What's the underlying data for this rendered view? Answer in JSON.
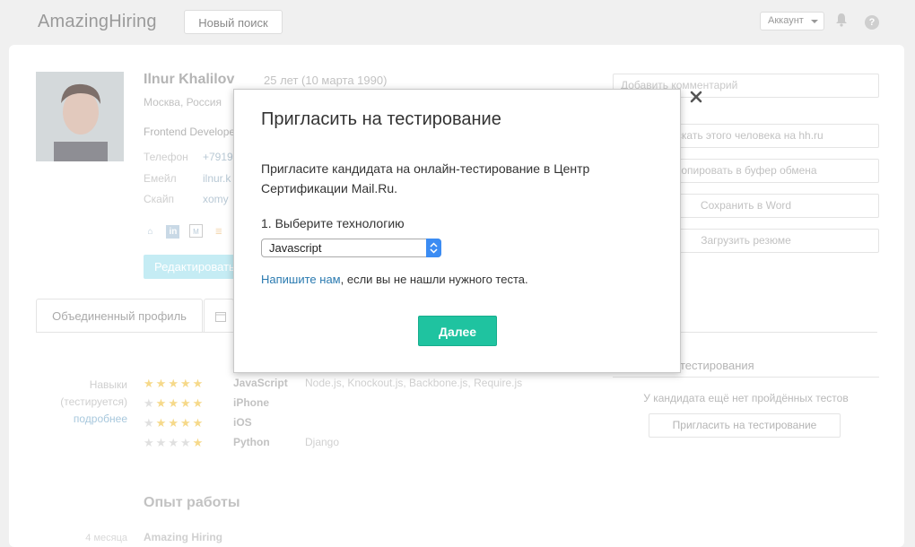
{
  "header": {
    "logo": "AmazingHiring",
    "new_search_label": "Новый поиск",
    "account_label": "Аккаунт",
    "help_label": "?"
  },
  "profile": {
    "name": "Ilnur Khalilov",
    "age": "25 лет (10 марта 1990)",
    "city": "Москва, Россия",
    "position": "Frontend Developer",
    "contacts": [
      {
        "label": "Телефон",
        "value": "+7919"
      },
      {
        "label": "Емейл",
        "value": "ilnur.k"
      },
      {
        "label": "Скайп",
        "value": "xomy"
      }
    ],
    "social_icons": [
      "home-icon",
      "linkedin-icon",
      "moikrug-icon",
      "stackoverflow-icon"
    ],
    "edit_label": "Редактировать"
  },
  "sidebar": {
    "comment_placeholder": "Добавить комментарий",
    "buttons": [
      {
        "label": "Искать этого человека на hh.ru"
      },
      {
        "label": "Копировать в буфер обмена"
      },
      {
        "label": "Сохранить в Word"
      },
      {
        "label": "Загрузить резюме"
      }
    ]
  },
  "tabs": {
    "unified_profile": "Объединенный профиль"
  },
  "skills": {
    "label_line1": "Навыки",
    "label_line2": "(тестируется)",
    "more_link": "подробнее",
    "rows": [
      {
        "stars": 5,
        "name": "JavaScript",
        "tags": "Node.js, Knockout.js, Backbone.js, Require.js"
      },
      {
        "stars": 4,
        "name": "iPhone",
        "tags": ""
      },
      {
        "stars": 4,
        "name": "iOS",
        "tags": ""
      },
      {
        "stars": 1,
        "name": "Python",
        "tags": "Django"
      }
    ]
  },
  "testing": {
    "heading": "тестирования",
    "no_tests": "У кандидата ещё нет пройдённых тестов",
    "invite_label": "Пригласить на тестирование"
  },
  "work": {
    "heading": "Опыт работы",
    "company": "Amazing Hiring",
    "date": "4 месяца"
  },
  "modal": {
    "title": "Пригласить на тестирование",
    "description": "Пригласите кандидата на онлайн-тестирование в Центр Сертификации Mail.Ru.",
    "step_label": "1. Выберите технологию",
    "selected_tech": "Javascript",
    "help_link": "Напишите нам",
    "help_rest": ", если вы не нашли нужного теста.",
    "next_label": "Далее"
  },
  "colors": {
    "accent_green": "#1fc3a0",
    "link_blue": "#2a7ab0",
    "select_blue": "#3b8cf3"
  }
}
